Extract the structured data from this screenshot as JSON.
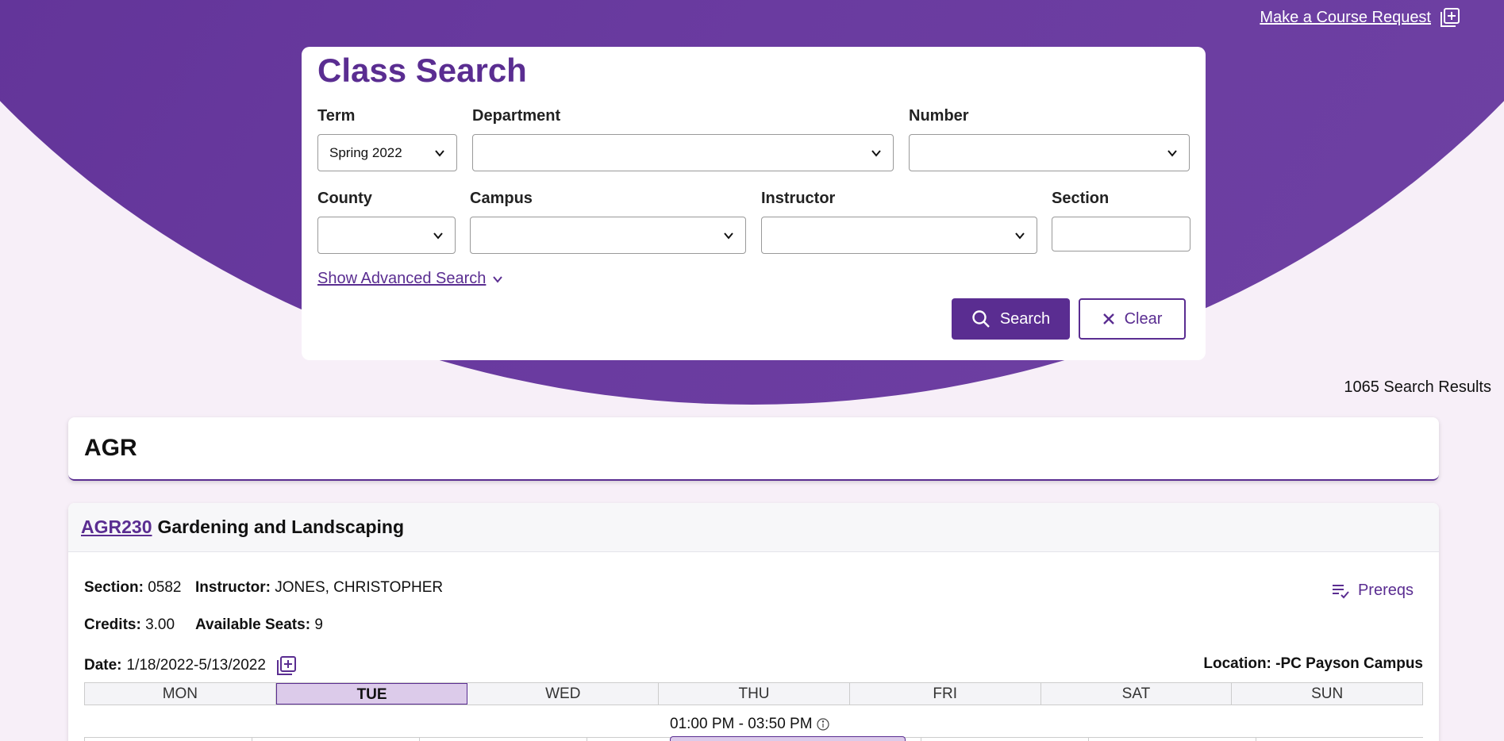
{
  "header": {
    "course_request_label": "Make a Course Request"
  },
  "search": {
    "title": "Class Search",
    "term_label": "Term",
    "term_value": "Spring 2022",
    "department_label": "Department",
    "department_value": "",
    "number_label": "Number",
    "number_value": "",
    "county_label": "County",
    "county_value": "",
    "campus_label": "Campus",
    "campus_value": "",
    "instructor_label": "Instructor",
    "instructor_value": "",
    "section_label": "Section",
    "section_value": "",
    "advanced_label": "Show Advanced Search",
    "search_button": "Search",
    "clear_button": "Clear"
  },
  "results": {
    "count_text": "1065 Search Results",
    "department": "AGR"
  },
  "course": {
    "code": "AGR230",
    "title": "Gardening and Landscaping",
    "section_label": "Section:",
    "section_value": "0582",
    "instructor_label": "Instructor:",
    "instructor_value": "JONES, CHRISTOPHER",
    "credits_label": "Credits:",
    "credits_value": "3.00",
    "seats_label": "Available Seats:",
    "seats_value": "9",
    "date_label": "Date:",
    "date_value": "1/18/2022-5/13/2022",
    "location_label": "Location:",
    "location_value": "-PC Payson Campus",
    "prereqs_label": "Prereqs",
    "days": [
      "MON",
      "TUE",
      "WED",
      "THU",
      "FRI",
      "SAT",
      "SUN"
    ],
    "active_day": "TUE",
    "time": "01:00 PM - 03:50 PM"
  },
  "colors": {
    "brand": "#5a2d91",
    "page_bg": "#f7eff8",
    "active_day_bg": "#dccbea"
  }
}
